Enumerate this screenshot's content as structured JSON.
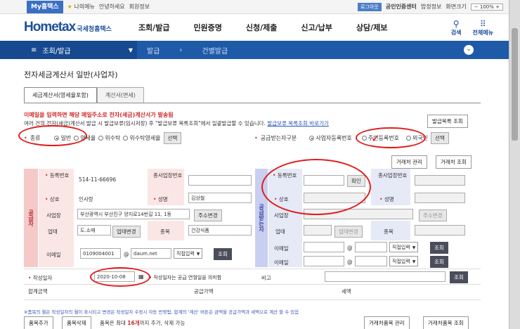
{
  "topbar": {
    "my_tab": "My홈택스",
    "my_menu": "나의메뉴",
    "greeting": "안녕하세요",
    "member_info": "회원정보",
    "logout": "로그아웃",
    "cert_center": "공인인증센터",
    "site_map": "밥정정보",
    "screen_size": "화면크기",
    "zoom": "100%"
  },
  "header": {
    "logo": "Hometax",
    "logo_sub": "국세청홈택스",
    "nav": [
      "조회/발급",
      "민원증명",
      "신청/제출",
      "신고/납부",
      "상담/제보"
    ],
    "search": "검색",
    "all_menu": "전체메뉴"
  },
  "bluebar": {
    "menu_title": "조회/발급",
    "crumb1": "발급",
    "crumb2": "건별발급"
  },
  "page_title": "전자세금계산서 일반(사업자)",
  "tabs": [
    "세금계산서(영세율포함)",
    "계산서(면세)"
  ],
  "notice": {
    "warning": "이메일을 입력하면 해당 메일주소로 전자(세금)계산서가 발송됨",
    "line2_prefix": "여러 건의 전자(세금)계산서 발급 시 발급보류(임시저장) 후 \"발급보류 목록조회\"에서 일괄발급할 수 있습니다.",
    "line2_link": "발급보류 목록조회 바로가기",
    "list_button": "발급목록 조회"
  },
  "kind": {
    "label": "종류",
    "options": [
      "일반",
      "영세율",
      "위수탁",
      "위수탁영세율"
    ],
    "select_button": "선택"
  },
  "recipient_type": {
    "label": "공급받는자구분",
    "options": [
      "사업자등록번호",
      "주민등록번호",
      "외국인"
    ],
    "select_button": "선택"
  },
  "partner_buttons": [
    "거래처 관리",
    "거래처 조회"
  ],
  "supplier": {
    "side_label": "공급자",
    "reg_no_label": "등록번호",
    "reg_no": "514-11-66696",
    "branch_label": "종사업장번호",
    "name_label": "상호",
    "name": "인사랑",
    "rep_label": "성명",
    "rep": "김상철",
    "addr_label": "사업장",
    "addr": "부산광역시 부산진구 양지로14번길 11, 1동",
    "addr_button": "주소변경",
    "biz_label": "업태",
    "biz": "도.소매",
    "biz_button": "업태변경",
    "item_label": "종목",
    "item": "건강식품",
    "email_label": "이메일",
    "email_id": "0109004001",
    "email_at": "@",
    "email_domain": "daum.net",
    "email_select": "직접입력",
    "lookup_button": "조회"
  },
  "buyer": {
    "side_label": "공급받는자",
    "reg_no_label": "등록번호",
    "confirm_button": "확인",
    "branch_label": "종사업장번호",
    "name_label": "상호",
    "rep_label": "성명",
    "addr_label": "사업장",
    "addr_button": "주소변경",
    "biz_label": "업태",
    "biz_button": "업태변경",
    "item_label": "종목",
    "email_label": "이메일",
    "email_at": "@",
    "email_select": "직접입력",
    "lookup_button": "조회"
  },
  "write_date": {
    "label": "작성일자",
    "value": "2020-10-08",
    "note": "작성일자는 공급 연월일을 의미함",
    "remark_label": "비고",
    "lookup_button": "조회"
  },
  "totals": {
    "sum_label": "합계금액",
    "supply_label": "공급가액",
    "tax_label": "세액"
  },
  "footer": {
    "note": "※품목의 월은 작성일자의 월이 표시되고 변경은 작성일자 수정시 자동 반영됨, 합계의 '계산' 버튼은 금액을 공급가액과 세액으로 계산 할 수 있음",
    "add_item": "품목추가",
    "delete_item": "품목삭제",
    "limit_prefix": "품목은 최대",
    "limit_count": "16개",
    "limit_suffix": "까지 추가, 삭제 가능",
    "item_manage": "거래처품목 관리",
    "item_lookup": "거래처품목 조회"
  }
}
